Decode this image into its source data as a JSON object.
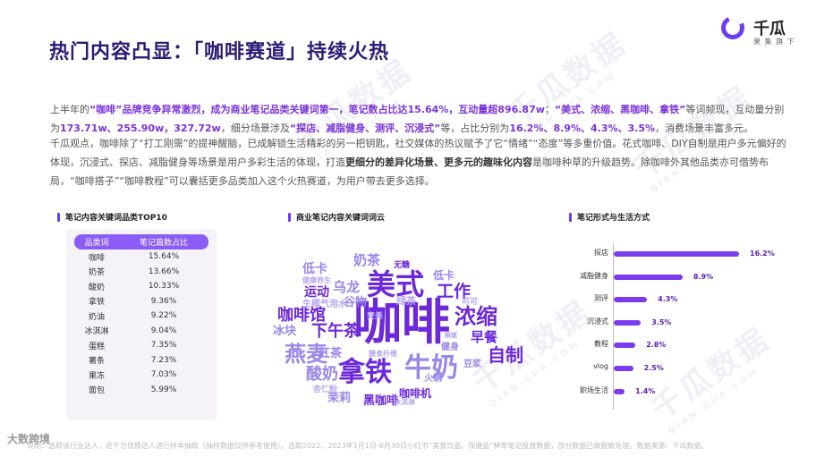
{
  "title": "热门内容凸显：「咖啡赛道」持续火热",
  "logo": {
    "name": "千瓜",
    "sub": "果 集 旗 下"
  },
  "para1": {
    "p1": "上半年的",
    "h1": "“咖啡”品牌竞争异常激烈，成为商业笔记品类关键词第一，笔记数占比达15.64%，互动量超896.87w",
    "p2": "；",
    "h2": "“美式、浓缩、黑咖啡、拿铁”",
    "p3": "等词频现，互动量分别为",
    "h3": "173.71w、255.90w，327.72w",
    "p4": "，细分场景涉及",
    "h4": "“探店、减脂健身、测评、沉浸式”",
    "p5": "等，占比分别为",
    "h5": "16.2%、8.9%、4.3%、3.5%",
    "p6": "，消费场景丰富多元。"
  },
  "para2": {
    "p1": "千瓜观点，咖啡除了“打工刚需”的提神醒脑，已成解锁生活精彩的另一把钥匙，社交媒体的热议赋予了它“情绪”“态度”等多重价值。花式咖啡、DIY自制是用户多元偏好的体现，沉浸式、探店、减脂健身等场景是用户多彩生活的体现，打造",
    "h1": "更细分的差异化场景、更多元的趣味化内容",
    "p2": "是咖啡种草的升级趋势。除咖啡外其他品类亦可借势布局，“咖啡搭子”“咖啡教程”可以囊括更多品类加入这个火热赛道，为用户带去更多选择。"
  },
  "section_table": {
    "title": "笔记内容关键词品类TOP10",
    "headers": [
      "品类词",
      "笔记篇数占比"
    ],
    "rows": [
      [
        "咖啡",
        "15.64%"
      ],
      [
        "奶茶",
        "13.66%"
      ],
      [
        "酸奶",
        "10.33%"
      ],
      [
        "拿铁",
        "9.36%"
      ],
      [
        "奶油",
        "9.22%"
      ],
      [
        "冰淇淋",
        "9.04%"
      ],
      [
        "蛋糕",
        "7.35%"
      ],
      [
        "薯条",
        "7.23%"
      ],
      [
        "果冻",
        "7.03%"
      ],
      [
        "面包",
        "5.99%"
      ]
    ]
  },
  "section_cloud": {
    "title": "商业笔记内容关键词词云",
    "words": [
      {
        "t": "咖啡",
        "c": "#6d28d9"
      },
      {
        "t": "美式",
        "c": "#6d28d9"
      },
      {
        "t": "拿铁",
        "c": "#6d28d9"
      },
      {
        "t": "牛奶",
        "c": "#9b87e8"
      },
      {
        "t": "燕麦",
        "c": "#9b87e8"
      },
      {
        "t": "浓缩",
        "c": "#6d28d9"
      },
      {
        "t": "工作",
        "c": "#6d28d9"
      },
      {
        "t": "自制",
        "c": "#6d28d9"
      },
      {
        "t": "咖啡馆",
        "c": "#6d28d9"
      },
      {
        "t": "下午茶",
        "c": "#6d28d9"
      },
      {
        "t": "酸奶",
        "c": "#9b87e8"
      },
      {
        "t": "早餐",
        "c": "#6d28d9"
      },
      {
        "t": "奶茶",
        "c": "#9b87e8"
      },
      {
        "t": "乌龙",
        "c": "#9b87e8"
      },
      {
        "t": "运动",
        "c": "#6d28d9"
      },
      {
        "t": "低卡",
        "c": "#9b87e8"
      },
      {
        "t": "低卡",
        "c": "#9b87e8"
      },
      {
        "t": "谷物",
        "c": "#9b87e8"
      },
      {
        "t": "冰块",
        "c": "#9b87e8"
      },
      {
        "t": "红茶",
        "c": "#9b87e8"
      },
      {
        "t": "茉莉",
        "c": "#9b87e8"
      },
      {
        "t": "黑咖啡",
        "c": "#6d28d9"
      },
      {
        "t": "咖啡机",
        "c": "#6d28d9"
      },
      {
        "t": "杏仁粉",
        "c": "#b8a8ee"
      },
      {
        "t": "火锅",
        "c": "#9b87e8"
      },
      {
        "t": "健身",
        "c": "#9b87e8"
      },
      {
        "t": "豆浆",
        "c": "#9b87e8"
      },
      {
        "t": "绿茶",
        "c": "#b8a8ee"
      },
      {
        "t": "无糖",
        "c": "#6d28d9"
      },
      {
        "t": "生椰气泡水",
        "c": "#b8a8ee"
      },
      {
        "t": "健康养生",
        "c": "#b8a8ee"
      },
      {
        "t": "可可",
        "c": "#b8a8ee"
      },
      {
        "t": "安美",
        "c": "#b8a8ee"
      },
      {
        "t": "膳食纤维",
        "c": "#b8a8ee"
      },
      {
        "t": "冰淇淋",
        "c": "#b8a8ee"
      },
      {
        "t": "解腻",
        "c": "#b8a8ee"
      }
    ]
  },
  "section_bars": {
    "title": "笔记形式与生活方式",
    "color": "#7c3aed",
    "items": [
      {
        "label": "探店",
        "value": 16.2,
        "text": "16.2%"
      },
      {
        "label": "减脂健身",
        "value": 8.9,
        "text": "8.9%"
      },
      {
        "label": "测评",
        "value": 4.3,
        "text": "4.3%"
      },
      {
        "label": "沉浸式",
        "value": 3.5,
        "text": "3.5%"
      },
      {
        "label": "教程",
        "value": 2.8,
        "text": "2.8%"
      },
      {
        "label": "vlog",
        "value": 2.5,
        "text": "2.5%"
      },
      {
        "label": "职场生活",
        "value": 1.4,
        "text": "1.4%"
      }
    ]
  },
  "footer": "说明：选取该行业达人，近千万优质达人进行样本抽取（抽样数据仅供参考使用）。选取2022、2023年1月1日-6月30日小红书“美食饮品、保健品”种草笔记投放数据，部分数据已做脱敏处理，数据来源：千瓜数据。",
  "corner_logo": "大数跨境"
}
